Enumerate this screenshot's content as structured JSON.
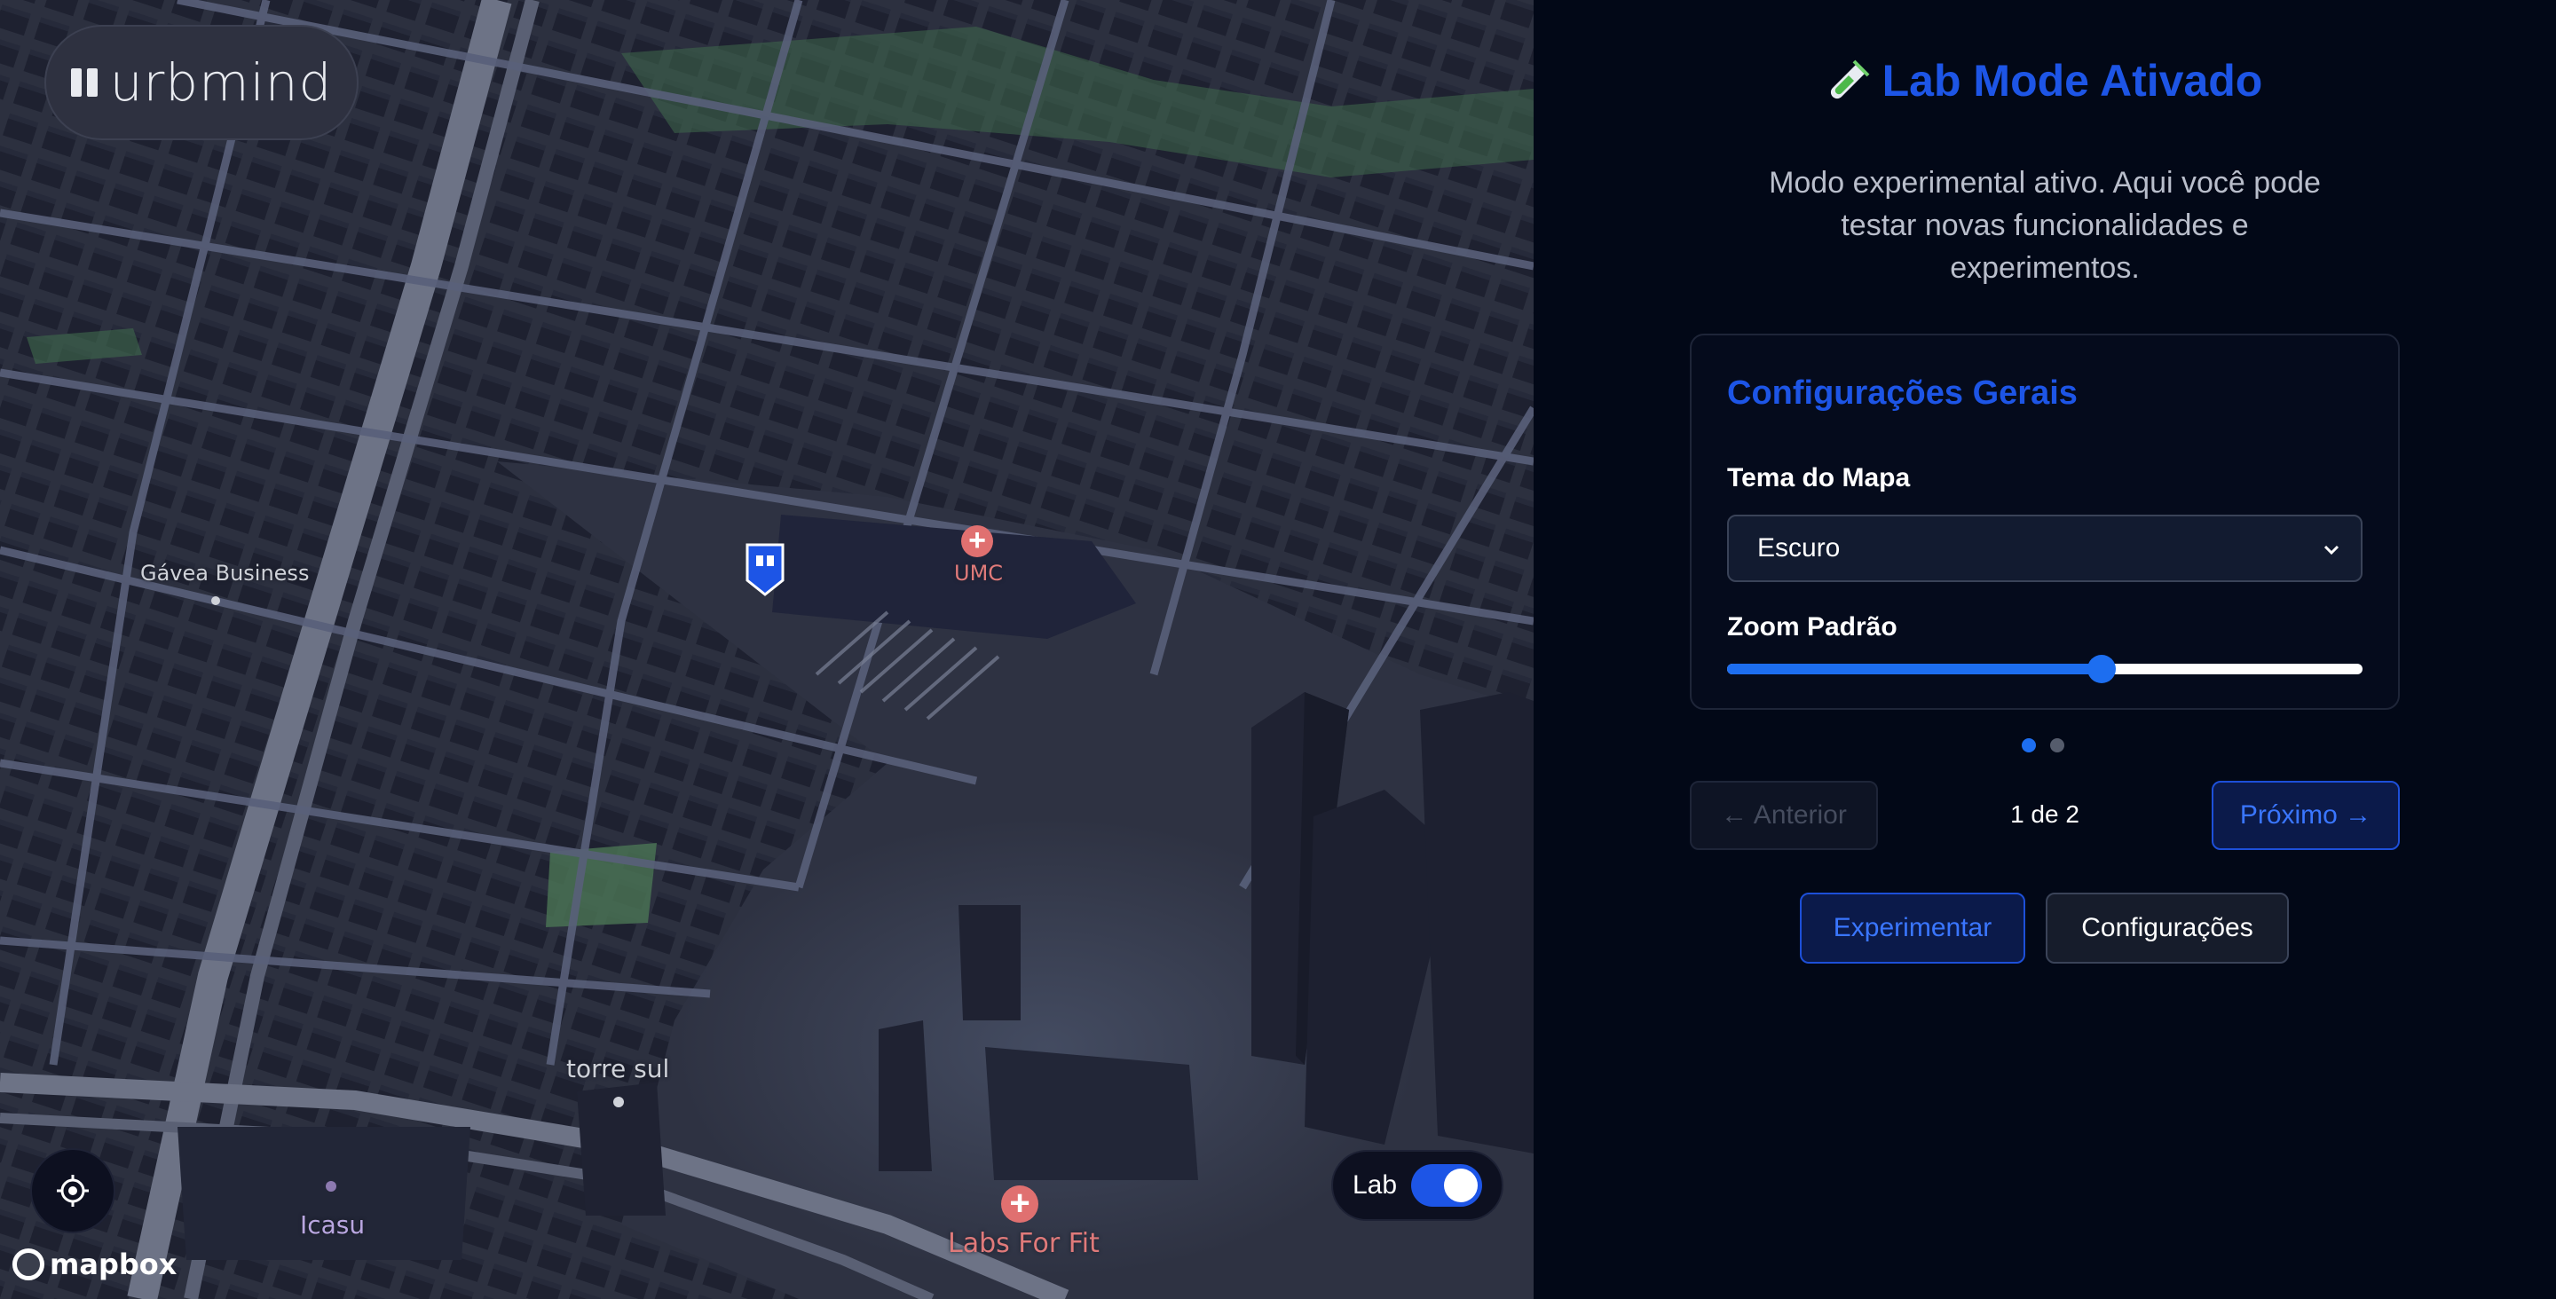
{
  "brand": {
    "name": "urbmind"
  },
  "map": {
    "labels": {
      "gavea": "Gávea Business",
      "umc": "UMC",
      "torre_sul": "torre sul",
      "icasu": "Icasu",
      "labs_for_fit": "Labs For Fit"
    },
    "attribution": "mapbox",
    "lab_toggle": {
      "label": "Lab",
      "enabled": true
    }
  },
  "panel": {
    "title": "Lab Mode Ativado",
    "description": "Modo experimental ativo. Aqui você pode testar novas funcionalidades e experimentos.",
    "card": {
      "title": "Configurações Gerais",
      "map_theme_label": "Tema do Mapa",
      "map_theme_value": "Escuro",
      "zoom_label": "Zoom Padrão",
      "zoom_fraction": 0.59
    },
    "pagination": {
      "prev_label": "← Anterior",
      "indicator": "1 de 2",
      "next_label": "Próximo →",
      "current": 1,
      "total": 2
    },
    "actions": {
      "experiment_label": "Experimentar",
      "settings_label": "Configurações"
    }
  },
  "colors": {
    "accent": "#1d55e6",
    "panel_bg": "#020817",
    "poi_red": "#e07070"
  }
}
